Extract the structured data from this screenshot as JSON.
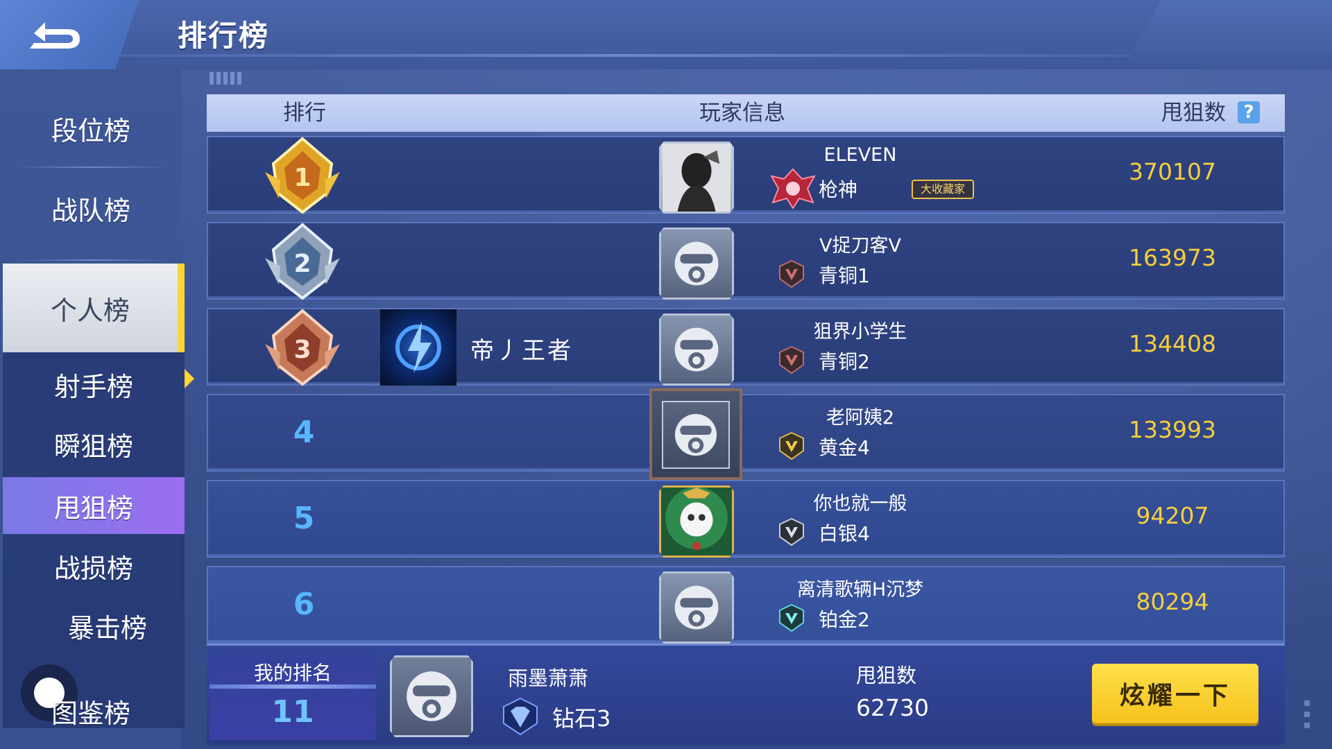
{
  "header": {
    "title": "排行榜"
  },
  "sidebar": {
    "items": [
      {
        "label": "段位榜"
      },
      {
        "label": "战队榜"
      },
      {
        "label": "个人榜"
      },
      {
        "label": "射手榜"
      },
      {
        "label": "瞬狙榜"
      },
      {
        "label": "甩狙榜"
      },
      {
        "label": "战损榜"
      },
      {
        "label": "暴击榜"
      },
      {
        "label": "图鉴榜"
      }
    ],
    "active_group": "个人榜",
    "active_sub": "甩狙榜"
  },
  "table": {
    "columns": {
      "rank": "排行",
      "player": "玩家信息",
      "score": "甩狙数"
    },
    "help_icon": "?",
    "rows": [
      {
        "rank": "1",
        "team": "",
        "name": "ELEVEN",
        "tier": "枪神",
        "tag": "大收藏家",
        "score": "370107"
      },
      {
        "rank": "2",
        "team": "",
        "name": "V捉刀客V",
        "tier": "青铜1",
        "tag": "",
        "score": "163973"
      },
      {
        "rank": "3",
        "team": "帝丿王者",
        "name": "狙界小学生",
        "tier": "青铜2",
        "tag": "",
        "score": "134408"
      },
      {
        "rank": "4",
        "team": "",
        "name": "老阿姨2",
        "tier": "黄金4",
        "tag": "",
        "score": "133993"
      },
      {
        "rank": "5",
        "team": "",
        "name": "你也就一般",
        "tier": "白银4",
        "tag": "",
        "score": "94207"
      },
      {
        "rank": "6",
        "team": "",
        "name": "离清歌辆H沉梦",
        "tier": "铂金2",
        "tag": "",
        "score": "80294"
      }
    ]
  },
  "my_rank": {
    "label": "我的排名",
    "value": "11",
    "name": "雨墨萧萧",
    "tier": "钻石3",
    "score_label": "甩狙数",
    "score_value": "62730",
    "show_button": "炫耀一下"
  },
  "colors": {
    "accent_yellow": "#ffd436",
    "score_gold": "#f7cf3b",
    "rank_blue": "#58b6ff",
    "active_tab_purple": "#8a74ec"
  }
}
